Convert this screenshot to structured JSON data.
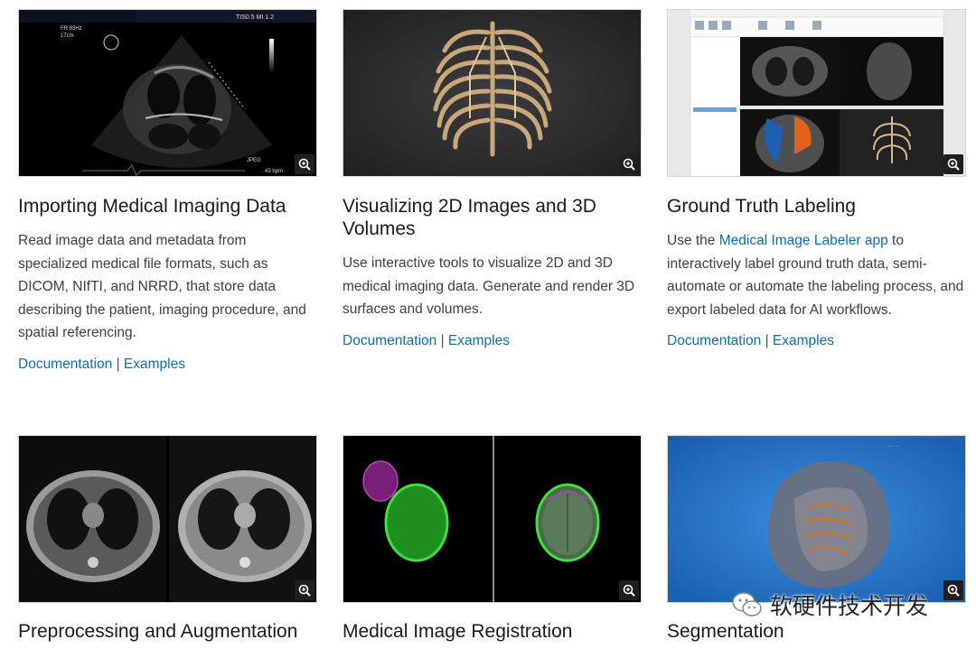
{
  "cards": [
    {
      "title": "Importing Medical Imaging Data",
      "description": "Read image data and metadata from specialized medical file formats, such as DICOM, NIfTI, and NRRD, that store data describing the patient, imaging procedure, and spatial referencing.",
      "doc_link": "Documentation",
      "separator": "|",
      "examples_link": "Examples",
      "thumb_text": {
        "top_right": "TIS0.5  MI 1.2",
        "top_left": "FR 83Hz",
        "depth": "17cm",
        "bottom_left": "JPEG",
        "bottom_right": "43 bpm"
      }
    },
    {
      "title": "Visualizing 2D Images and 3D Volumes",
      "description": "Use interactive tools to visualize 2D and 3D medical imaging data. Generate and render 3D surfaces and volumes.",
      "doc_link": "Documentation",
      "separator": "|",
      "examples_link": "Examples"
    },
    {
      "title": "Ground Truth Labeling",
      "description_prefix": "Use the ",
      "description_link": "Medical Image Labeler app",
      "description_suffix": " to interactively label ground truth data, semi-automate or automate the labeling process, and export labeled data for AI workflows.",
      "doc_link": "Documentation",
      "separator": "|",
      "examples_link": "Examples"
    },
    {
      "title": "Preprocessing and Augmentation"
    },
    {
      "title": "Medical Image Registration"
    },
    {
      "title": "Segmentation"
    }
  ],
  "watermark": {
    "text": "软硬件技术开发"
  },
  "colors": {
    "link": "#0b6fb3",
    "title": "#1a1a1a",
    "body": "#404040"
  }
}
